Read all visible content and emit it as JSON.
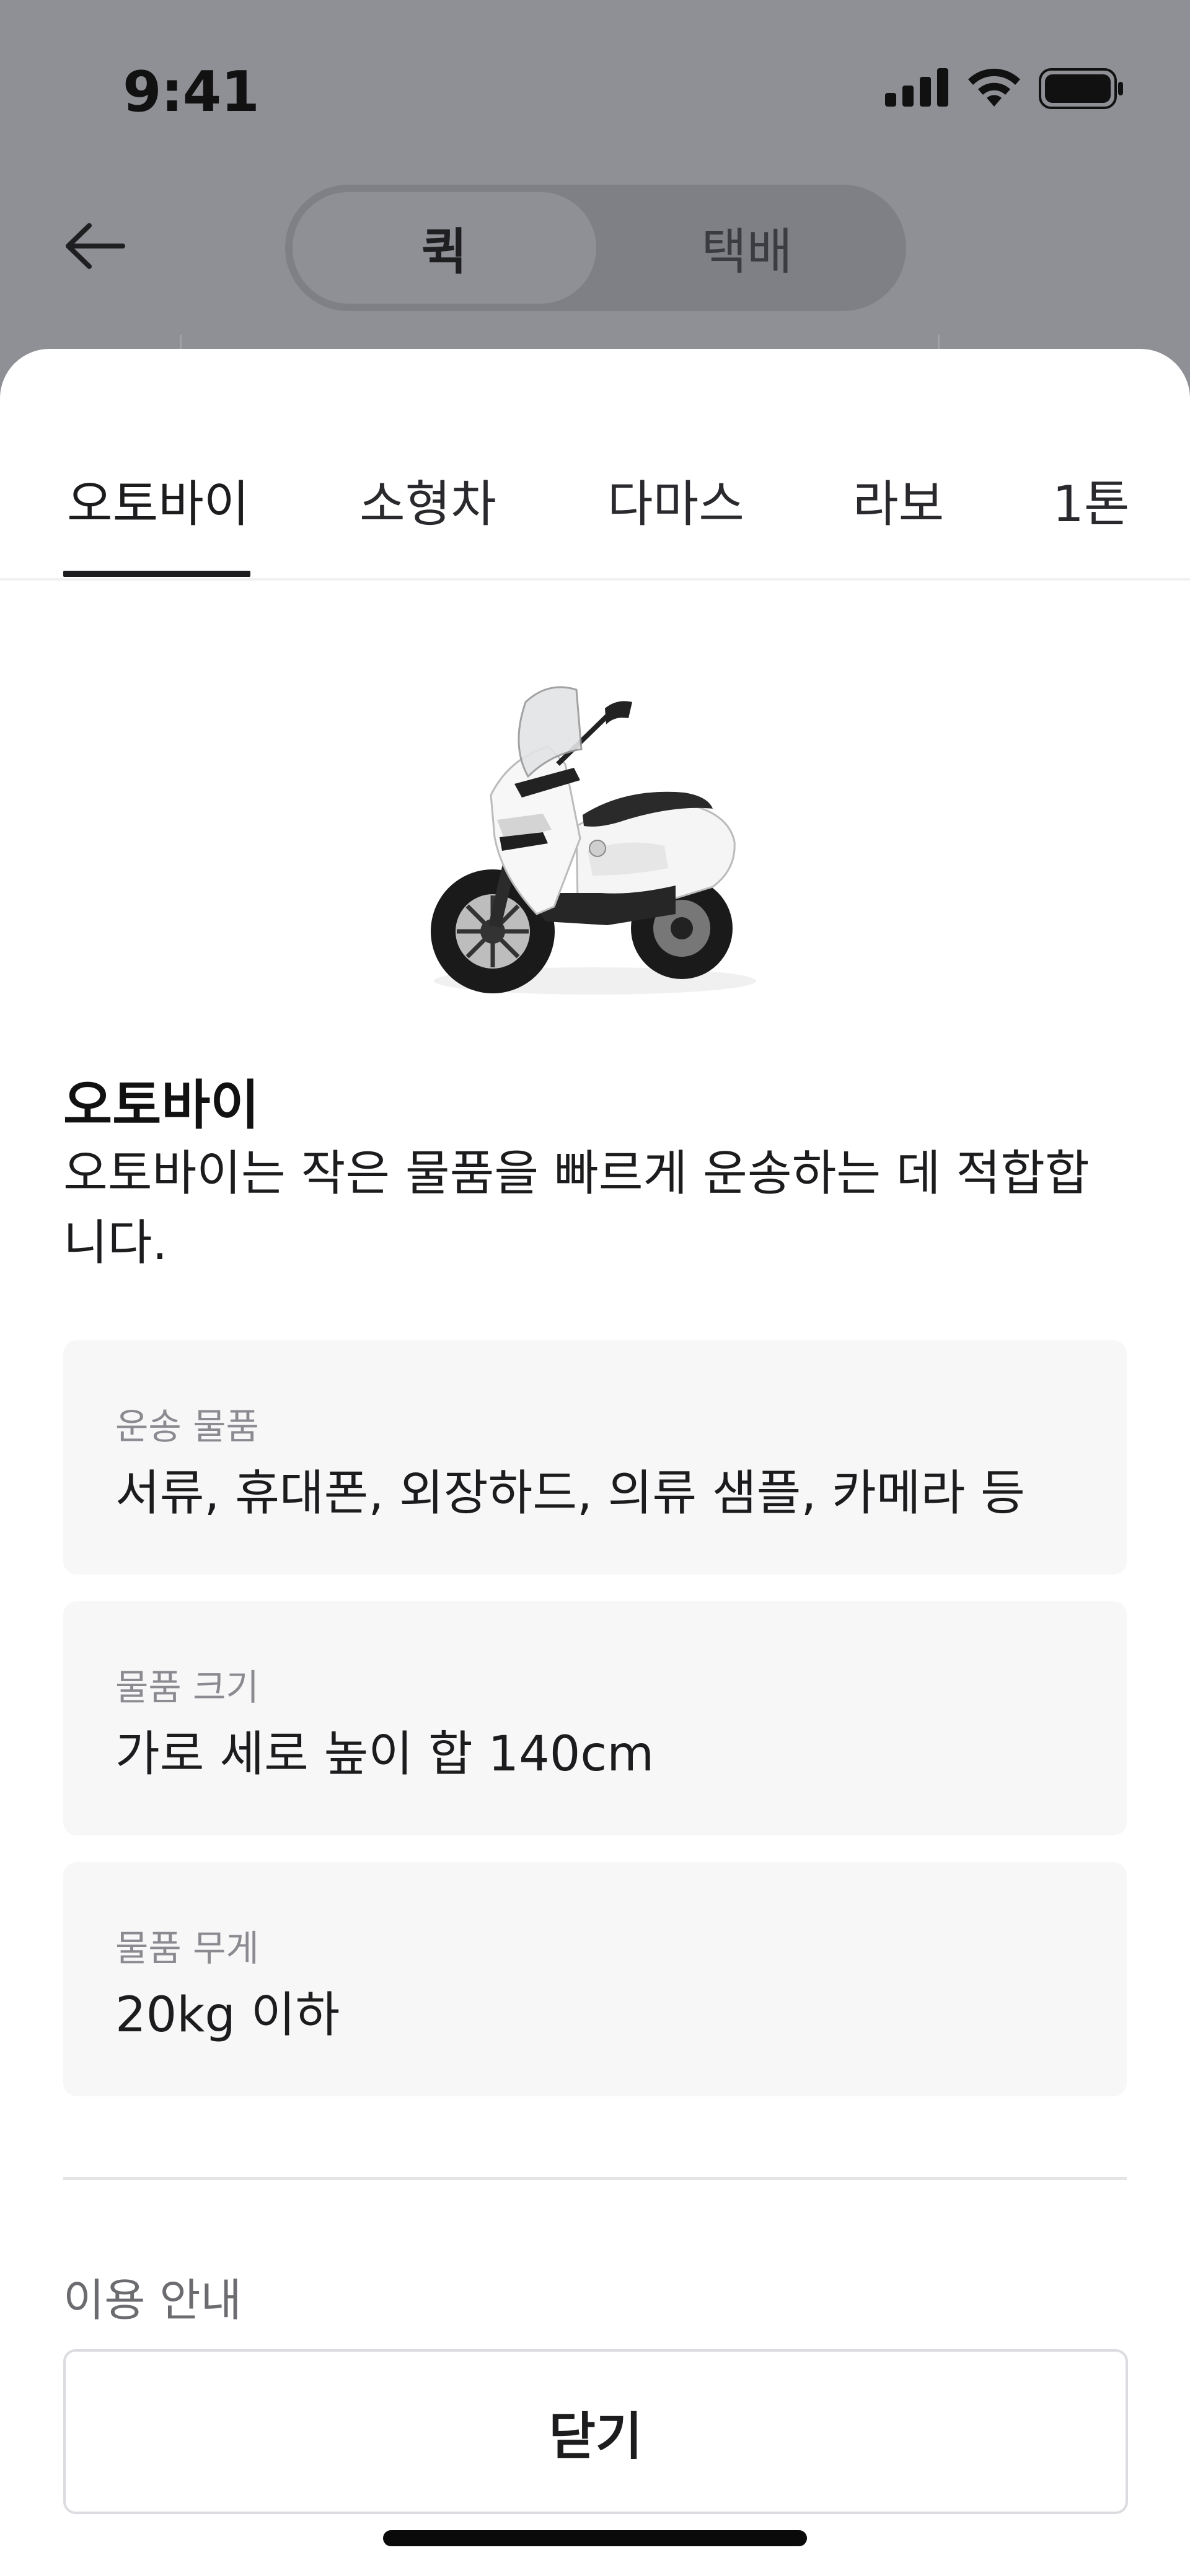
{
  "status_bar": {
    "time": "9:41",
    "icons": [
      "cellular-signal-icon",
      "wifi-icon",
      "battery-icon"
    ]
  },
  "header": {
    "back_icon": "arrow-left-icon",
    "segments": [
      {
        "label": "퀵",
        "selected": true
      },
      {
        "label": "택배",
        "selected": false
      }
    ]
  },
  "sheet": {
    "tabs": [
      {
        "label": "오토바이",
        "selected": true
      },
      {
        "label": "소형차",
        "selected": false
      },
      {
        "label": "다마스",
        "selected": false
      },
      {
        "label": "라보",
        "selected": false
      },
      {
        "label": "1톤",
        "selected": false
      }
    ],
    "vehicle": {
      "title": "오토바이",
      "description": "오토바이는 작은 물품을 빠르게 운송하는 데 적합합니다."
    },
    "info_cards": [
      {
        "label": "운송 물품",
        "value": "서류, 휴대폰, 외장하드, 의류 샘플, 카메라 등"
      },
      {
        "label": "물품 크기",
        "value": "가로 세로 높이 합 140cm"
      },
      {
        "label": "물품 무게",
        "value": "20kg 이하"
      }
    ],
    "usage_guide": "이용 안내",
    "close_label": "닫기"
  },
  "colors": {
    "dim_background": "#8e9096",
    "sheet_background": "#ffffff",
    "card_background": "#f7f7f8",
    "accent": "#1c1c1e"
  }
}
